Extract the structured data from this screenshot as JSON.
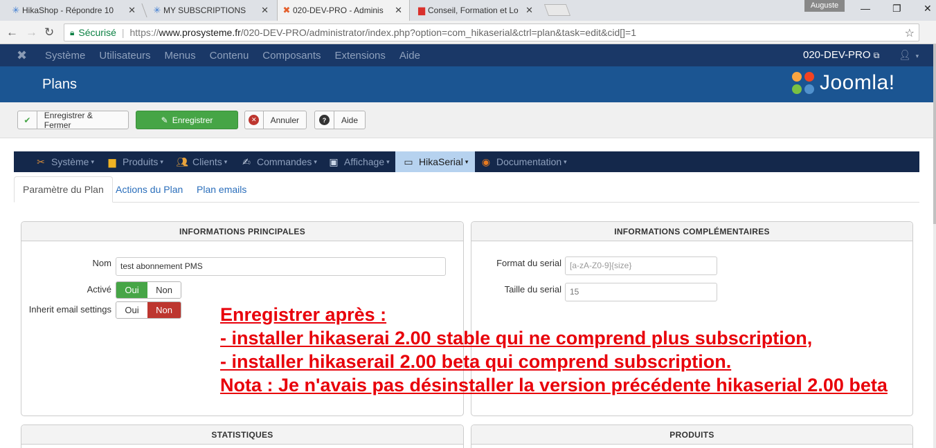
{
  "browser": {
    "tabs": [
      {
        "title": "HikaShop - Répondre 10",
        "icon": "hikashop-icon"
      },
      {
        "title": "MY SUBSCRIPTIONS",
        "icon": "hikashop-icon"
      },
      {
        "title": "020-DEV-PRO - Adminis",
        "icon": "joomla-icon"
      },
      {
        "title": "Conseil, Formation et Lo",
        "icon": "site-icon"
      }
    ],
    "profile": "Auguste",
    "secure_label": "Sécurisé",
    "url_scheme": "https://",
    "url_host": "www.prosysteme.fr",
    "url_path": "/020-DEV-PRO/administrator/index.php?option=com_hikaserial&ctrl=plan&task=edit&cid[]=1"
  },
  "joomla": {
    "menu": [
      "Système",
      "Utilisateurs",
      "Menus",
      "Contenu",
      "Composants",
      "Extensions",
      "Aide"
    ],
    "site_name": "020-DEV-PRO",
    "page_title": "Plans",
    "brand": "Joomla!"
  },
  "toolbar": {
    "save_close": "Enregistrer & Fermer",
    "save": "Enregistrer",
    "cancel": "Annuler",
    "help": "Aide"
  },
  "hikamenu": {
    "items": [
      "Système",
      "Produits",
      "Clients",
      "Commandes",
      "Affichage",
      "HikaSerial",
      "Documentation"
    ]
  },
  "tabs": [
    "Paramètre du Plan",
    "Actions du Plan",
    "Plan emails"
  ],
  "main_info": {
    "title": "INFORMATIONS PRINCIPALES",
    "name_label": "Nom",
    "name_value": "test abonnement PMS",
    "active_label": "Activé",
    "inherit_label": "Inherit email settings",
    "yes": "Oui",
    "no": "Non"
  },
  "extra_info": {
    "title": "INFORMATIONS COMPLÉMENTAIRES",
    "format_label": "Format du serial",
    "format_placeholder": "[a-zA-Z0-9]{size}",
    "size_label": "Taille du serial",
    "size_value": "15"
  },
  "stats": {
    "title": "STATISTIQUES"
  },
  "products": {
    "title": "PRODUITS"
  },
  "annotation": [
    "Enregistrer après :",
    "- installer hikaserai 2.00 stable qui ne comprend plus subscription,",
    "- installer hikaserail 2.00 beta qui comprend subscription.",
    "Nota : Je n'avais pas désinstaller la version précédente hikaserial 2.00 beta"
  ],
  "colors": {
    "joomla_nav": "#1a3867",
    "joomla_header": "#1b5592",
    "save_green": "#46a546",
    "no_red": "#bd362f",
    "annotation_red": "#e8000a",
    "active_menu": "#b6d2ef"
  }
}
